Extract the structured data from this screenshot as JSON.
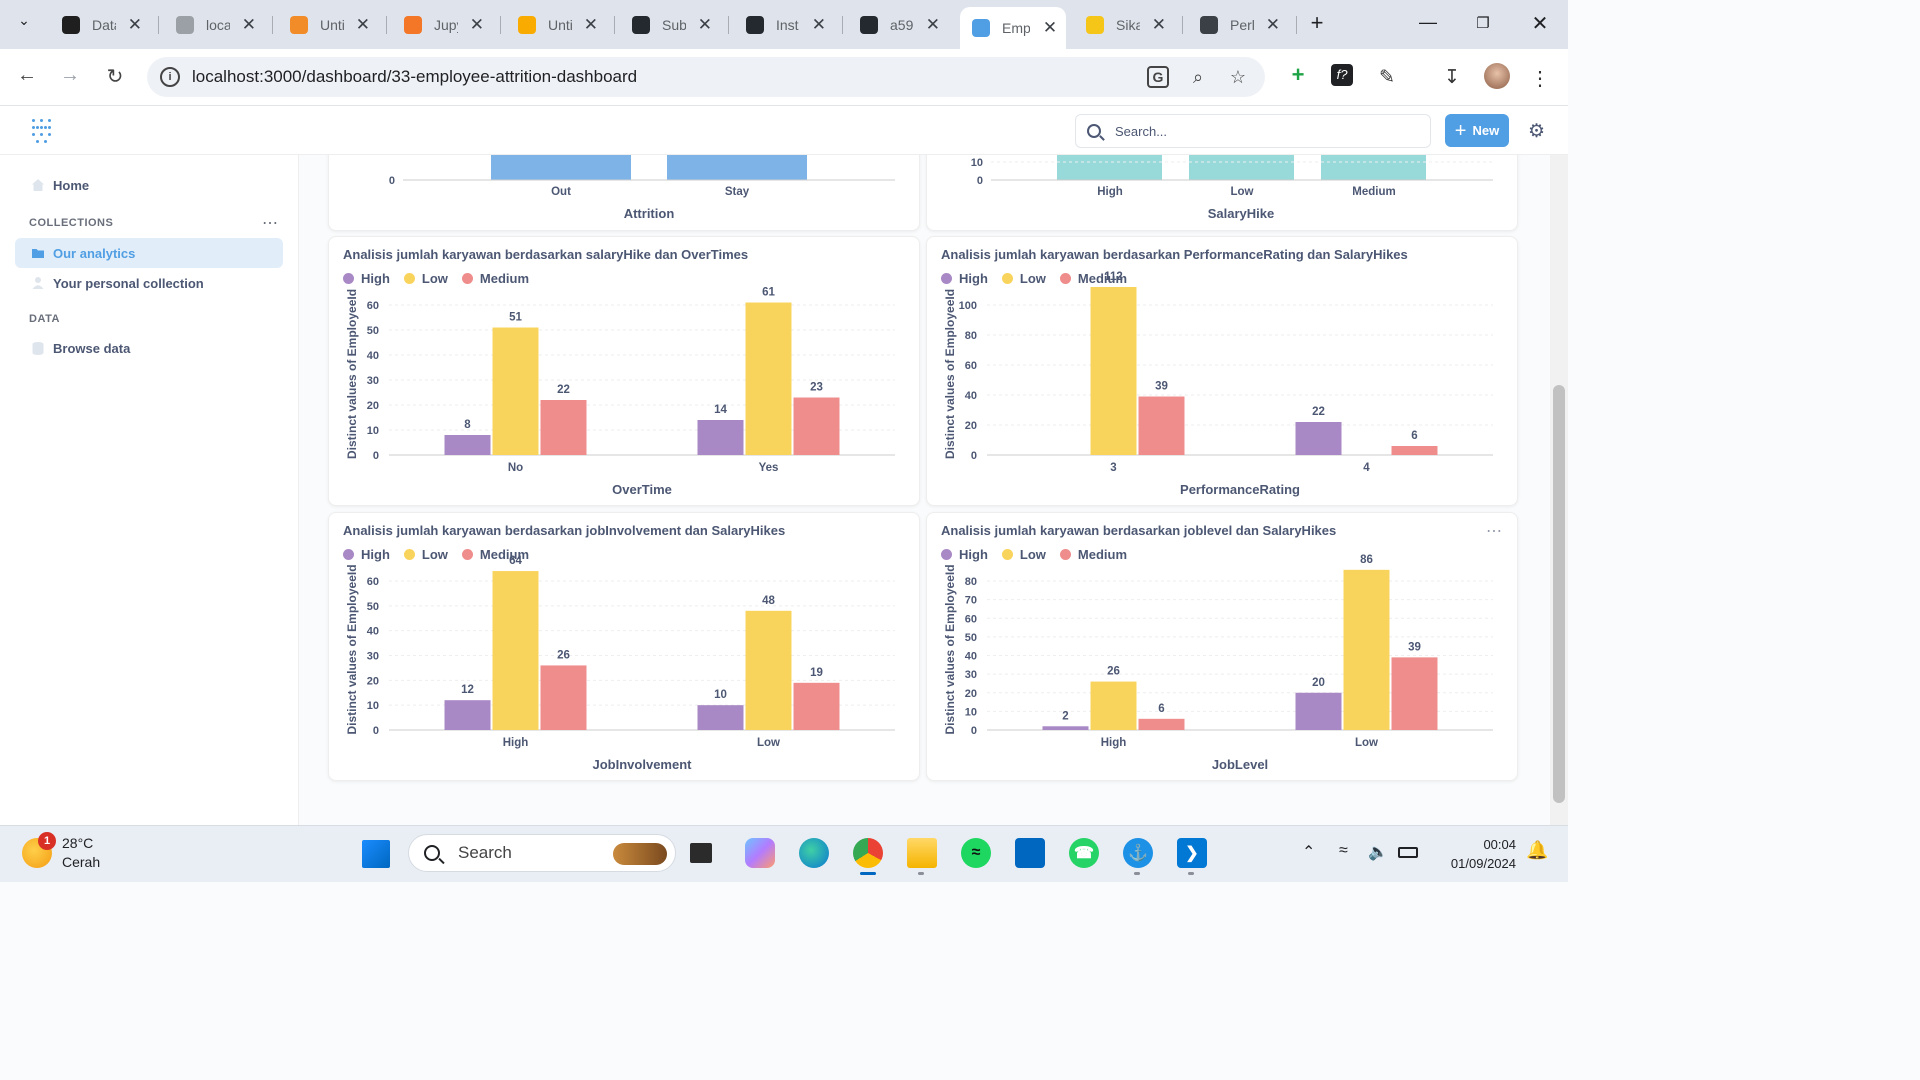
{
  "browser": {
    "tabs": [
      {
        "label": "Data",
        "icon": "supabase-icon",
        "color": "#1f1f1f"
      },
      {
        "label": "loca",
        "icon": "loading-icon",
        "color": "#9aa0a6"
      },
      {
        "label": "Unti",
        "icon": "notebook-icon",
        "color": "#f28c28"
      },
      {
        "label": "Jupy",
        "icon": "jupyter-icon",
        "color": "#f37726"
      },
      {
        "label": "Unti",
        "icon": "colab-icon",
        "color": "#f9ab00"
      },
      {
        "label": "Sub",
        "icon": "github-icon",
        "color": "#24292f"
      },
      {
        "label": "Inst",
        "icon": "github-icon",
        "color": "#24292f"
      },
      {
        "label": "a59",
        "icon": "github-icon",
        "color": "#24292f"
      },
      {
        "label": "Emp",
        "icon": "metabase-icon",
        "color": "#509ee3"
      },
      {
        "label": "Sika",
        "icon": "bulb-icon",
        "color": "#f5c518"
      },
      {
        "label": "Perl",
        "icon": "openai-icon",
        "color": "#3b3f46"
      }
    ],
    "url": "localhost:3000/dashboard/33-employee-attrition-dashboard"
  },
  "app": {
    "search_placeholder": "Search...",
    "new_label": "New"
  },
  "sidebar": {
    "home": "Home",
    "collections_heading": "COLLECTIONS",
    "our_analytics": "Our analytics",
    "personal": "Your personal collection",
    "data_heading": "DATA",
    "browse": "Browse data"
  },
  "legend": {
    "high": "High",
    "low": "Low",
    "medium": "Medium"
  },
  "colors": {
    "high": "#a989c5",
    "low": "#f9d45c",
    "medium": "#ef8c8c",
    "blue": "#7eb3e8",
    "teal": "#98d9d9"
  },
  "partial_cards": {
    "attrition": {
      "categories": [
        "Out",
        "Stay"
      ],
      "xlabel": "Attrition",
      "tick": "0"
    },
    "salaryhike": {
      "categories": [
        "High",
        "Low",
        "Medium"
      ],
      "xlabel": "SalaryHike",
      "ticks": [
        "10",
        "0"
      ]
    }
  },
  "chart_data": [
    {
      "type": "bar",
      "title": "Analisis jumlah karyawan berdasarkan salaryHike dan OverTimes",
      "categories": [
        "No",
        "Yes"
      ],
      "series": [
        {
          "name": "High",
          "values": [
            8,
            14
          ]
        },
        {
          "name": "Low",
          "values": [
            51,
            61
          ]
        },
        {
          "name": "Medium",
          "values": [
            22,
            23
          ]
        }
      ],
      "xlabel": "OverTime",
      "ylabel": "Distinct values of EmployeeId",
      "ylim": [
        0,
        60
      ],
      "yticks": [
        0,
        10,
        20,
        30,
        40,
        50,
        60
      ]
    },
    {
      "type": "bar",
      "title": "Analisis jumlah karyawan berdasarkan PerformanceRating dan SalaryHikes",
      "categories": [
        "3",
        "4"
      ],
      "series": [
        {
          "name": "High",
          "values": [
            0,
            22
          ]
        },
        {
          "name": "Low",
          "values": [
            112,
            0
          ]
        },
        {
          "name": "Medium",
          "values": [
            39,
            6
          ]
        }
      ],
      "xlabel": "PerformanceRating",
      "ylabel": "Distinct values of EmployeeId",
      "ylim": [
        0,
        100
      ],
      "yticks": [
        0,
        20,
        40,
        60,
        80,
        100
      ]
    },
    {
      "type": "bar",
      "title": "Analisis jumlah karyawan berdasarkan jobInvolvement dan SalaryHikes",
      "categories": [
        "High",
        "Low"
      ],
      "series": [
        {
          "name": "High",
          "values": [
            12,
            10
          ]
        },
        {
          "name": "Low",
          "values": [
            64,
            48
          ]
        },
        {
          "name": "Medium",
          "values": [
            26,
            19
          ]
        }
      ],
      "xlabel": "JobInvolvement",
      "ylabel": "Distinct values of EmployeeId",
      "ylim": [
        0,
        60
      ],
      "yticks": [
        0,
        10,
        20,
        30,
        40,
        50,
        60
      ]
    },
    {
      "type": "bar",
      "title": "Analisis jumlah karyawan berdasarkan joblevel dan SalaryHikes",
      "categories": [
        "High",
        "Low"
      ],
      "series": [
        {
          "name": "High",
          "values": [
            2,
            20
          ]
        },
        {
          "name": "Low",
          "values": [
            26,
            86
          ]
        },
        {
          "name": "Medium",
          "values": [
            6,
            39
          ]
        }
      ],
      "xlabel": "JobLevel",
      "ylabel": "Distinct values of EmployeeId",
      "ylim": [
        0,
        80
      ],
      "yticks": [
        0,
        10,
        20,
        30,
        40,
        50,
        60,
        70,
        80
      ]
    }
  ],
  "taskbar": {
    "temp": "28°C",
    "weather": "Cerah",
    "weather_badge": "1",
    "search": "Search",
    "time": "00:04",
    "date": "01/09/2024"
  }
}
